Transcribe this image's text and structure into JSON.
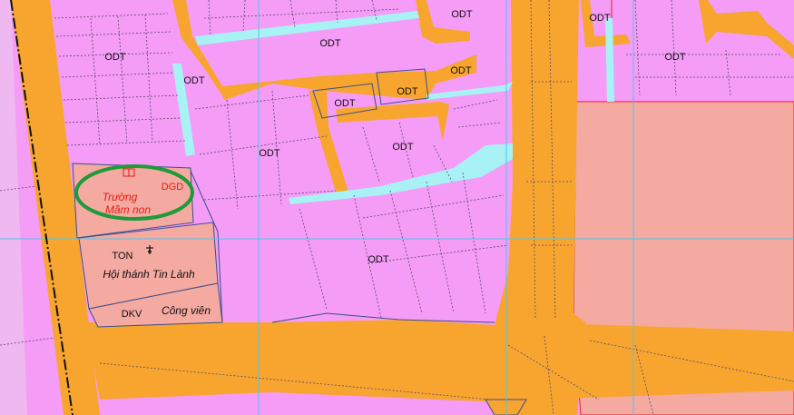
{
  "colors": {
    "residential_odt": "#f59cf6",
    "road": "#f7a52f",
    "education_dgd": "#f4a9a1",
    "religious_ton": "#f4a9a1",
    "park_dkv": "#f4a9a1",
    "large_block": "#f4a9a1",
    "water": "#a8f2f5",
    "grid_line": "#4fc6e8",
    "highlight_ring": "#1f9a3a",
    "boundary_red": "#e8202a"
  },
  "labels": {
    "odt": "ODT",
    "dgd": "DGD",
    "ton": "TON",
    "dkv": "DKV",
    "school_line1": "Trường",
    "school_line2": "Mầm non",
    "church": "Hội thánh Tin Lành",
    "park": "Công viên"
  },
  "icons": {
    "school": "school-book-icon",
    "church": "church-cross-icon"
  }
}
